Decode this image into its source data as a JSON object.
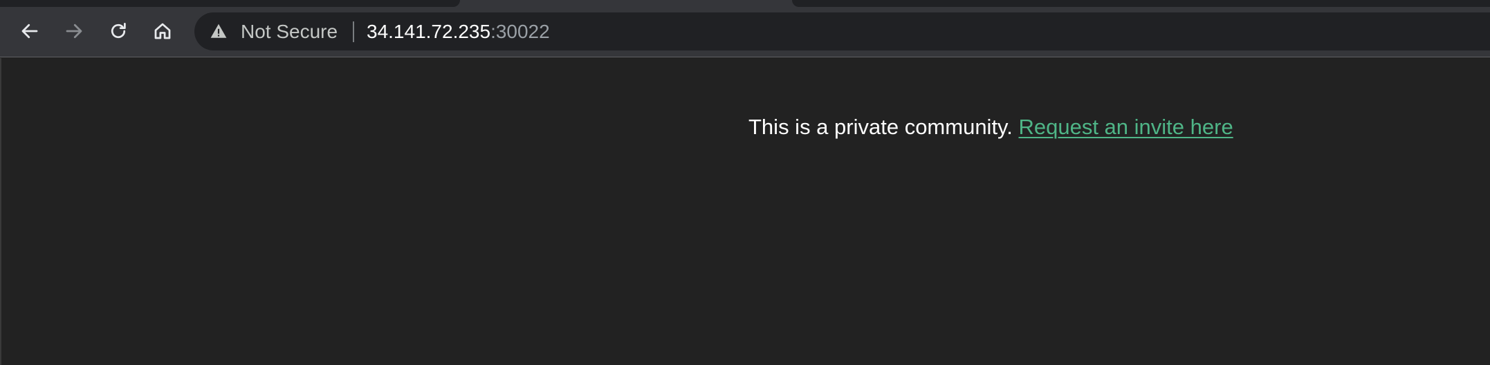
{
  "browser": {
    "security_label": "Not Secure",
    "url_host": "34.141.72.235",
    "url_port": ":30022",
    "icons": {
      "back": "back-arrow-icon",
      "forward": "forward-arrow-icon",
      "reload": "reload-icon",
      "home": "home-icon",
      "security": "warning-triangle-icon"
    },
    "colors": {
      "toolbar_bg": "#35363a",
      "omnibox_bg": "#202124",
      "url_text": "#ffffff",
      "port_text": "#9aa0a6"
    }
  },
  "page": {
    "message_text": "This is a private community. ",
    "invite_link_text": "Request an invite here",
    "colors": {
      "background": "#222222",
      "text": "#ffffff",
      "link": "#4fb587"
    }
  }
}
